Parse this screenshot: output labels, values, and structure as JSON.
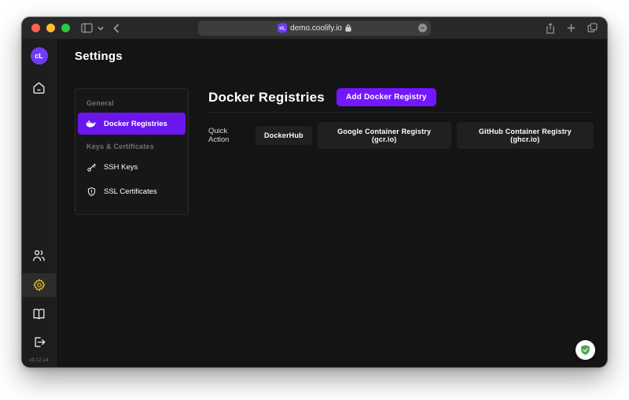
{
  "browser": {
    "address": "demo.coolify.io",
    "favicon_text": "cL"
  },
  "sidebar": {
    "logo_text": "cL",
    "version": "v3.12.14"
  },
  "page": {
    "title": "Settings"
  },
  "settings_nav": {
    "sections": [
      {
        "label": "General",
        "items": [
          {
            "label": "Docker Registries",
            "icon": "docker-icon",
            "active": true
          }
        ]
      },
      {
        "label": "Keys & Certificates",
        "items": [
          {
            "label": "SSH Keys",
            "icon": "key-icon",
            "active": false
          },
          {
            "label": "SSL Certificates",
            "icon": "shield-icon",
            "active": false
          }
        ]
      }
    ]
  },
  "main": {
    "heading": "Docker Registries",
    "add_button_label": "Add Docker Registry",
    "quick_action_label": "Quick Action",
    "quick_actions": [
      "DockerHub",
      "Google Container Registry (gcr.io)",
      "GitHub Container Registry (ghcr.io)"
    ]
  },
  "colors": {
    "accent_purple": "#6B16ED",
    "button_purple": "#7317FF",
    "active_gear_yellow": "#E7C229",
    "badge_green": "#4CA754",
    "window_bg": "#141414",
    "titlebar_bg": "#282828"
  }
}
